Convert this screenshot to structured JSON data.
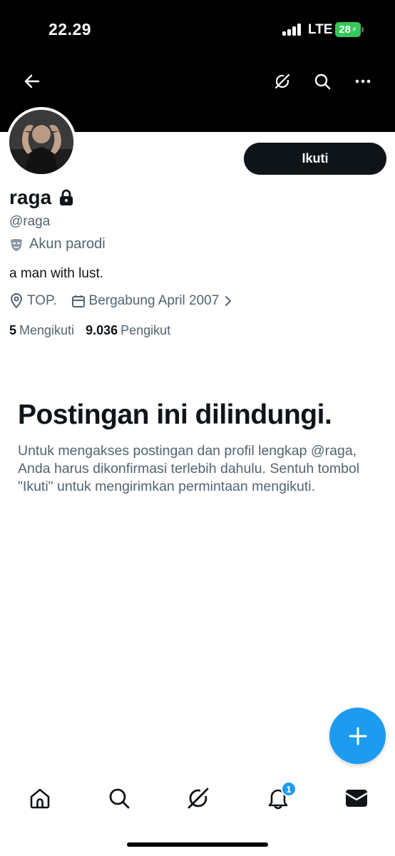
{
  "status_bar": {
    "time": "22.29",
    "network": "LTE",
    "battery": "28"
  },
  "header": {
    "icons": [
      "arrow-left-icon",
      "grok-icon",
      "search-icon",
      "more-dots-icon"
    ]
  },
  "profile": {
    "follow_label": "Ikuti",
    "display_name": "raga",
    "handle": "@raga",
    "parody_label": "Akun parodi",
    "bio": "a man with lust.",
    "location": "TOP.",
    "joined": "Bergabung April 2007",
    "following_count": "5",
    "following_label": "Mengikuti",
    "followers_count": "9.036",
    "followers_label": "Pengikut"
  },
  "protected": {
    "title": "Postingan ini dilindungi.",
    "description": "Untuk mengakses postingan dan profil lengkap @raga, Anda harus dikonfirmasi terlebih dahulu. Sentuh tombol \"Ikuti\" untuk mengirimkan permintaan mengikuti."
  },
  "bottom_nav": {
    "items": [
      "home-icon",
      "search-icon",
      "grok-icon",
      "bell-icon",
      "mail-icon"
    ],
    "notification_badge": "1"
  },
  "colors": {
    "accent": "#1d9bf0",
    "text_primary": "#0f1419",
    "text_secondary": "#536471",
    "header_bg": "#000000",
    "battery": "#34c759"
  }
}
